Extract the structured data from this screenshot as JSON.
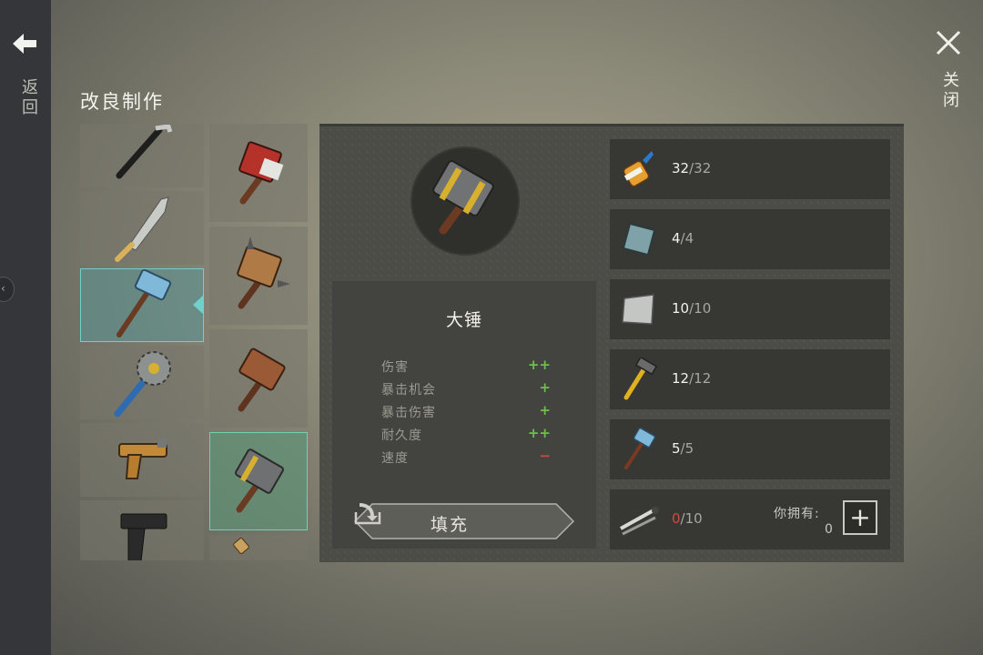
{
  "nav": {
    "back_label": "返回",
    "close_label": "关闭"
  },
  "page_title": "改良制作",
  "item_list_column1": [
    {
      "icon": "crowbar-icon"
    },
    {
      "icon": "machete-icon"
    },
    {
      "icon": "blue-sledgehammer-icon",
      "selected": true
    },
    {
      "icon": "saw-blade-club-icon"
    },
    {
      "icon": "flare-pistol-icon"
    },
    {
      "icon": "pistol-icon"
    }
  ],
  "item_list_column2": [
    {
      "icon": "upgrade-hammer-red-icon"
    },
    {
      "icon": "upgrade-hammer-spiked-icon"
    },
    {
      "icon": "upgrade-hammer-rusty-icon"
    },
    {
      "icon": "sledgehammer-icon",
      "selected": true
    },
    {
      "icon": "upgrade-partial-icon"
    }
  ],
  "selected_item": {
    "name": "大锤",
    "icon": "sledgehammer-icon",
    "stats": [
      {
        "name": "伤害",
        "value": "++",
        "color": "#6cc04a"
      },
      {
        "name": "暴击机会",
        "value": "+",
        "color": "#6cc04a"
      },
      {
        "name": "暴击伤害",
        "value": "+",
        "color": "#6cc04a"
      },
      {
        "name": "耐久度",
        "value": "++",
        "color": "#6cc04a"
      },
      {
        "name": "速度",
        "value": "−",
        "color": "#d04a40"
      }
    ],
    "fill_button": "填充"
  },
  "materials": [
    {
      "icon": "glue-icon",
      "have": "32",
      "sep": "/",
      "need": "32"
    },
    {
      "icon": "steel-plate-icon",
      "have": "4",
      "sep": "/",
      "need": "4"
    },
    {
      "icon": "metal-sheet-icon",
      "have": "10",
      "sep": "/",
      "need": "10"
    },
    {
      "icon": "hammer-icon",
      "have": "12",
      "sep": "/",
      "need": "12"
    },
    {
      "icon": "blue-sledgehammer-icon",
      "have": "5",
      "sep": "/",
      "need": "5"
    },
    {
      "icon": "metal-parts-icon",
      "have": "0",
      "sep": "/",
      "need": "10",
      "short": true,
      "own_label": "你拥有:",
      "own_value": "0"
    }
  ]
}
